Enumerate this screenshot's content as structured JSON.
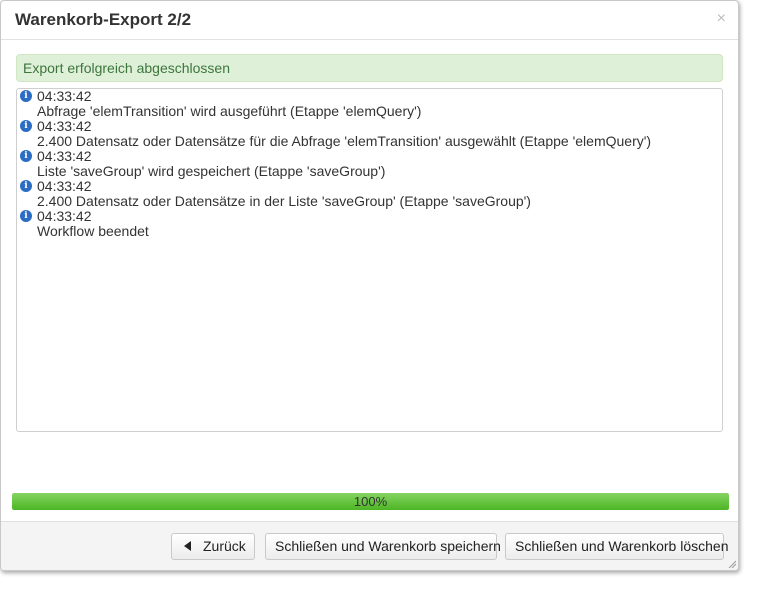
{
  "dialog": {
    "title": "Warenkorb-Export 2/2",
    "close_symbol": "×",
    "success_message": "Export erfolgreich abgeschlossen",
    "log": [
      {
        "time": "04:33:42",
        "message": "Abfrage 'elemTransition' wird ausgeführt (Etappe 'elemQuery')",
        "icon": "info-icon"
      },
      {
        "time": "04:33:42",
        "message": "2.400 Datensatz oder Datensätze für die Abfrage 'elemTransition' ausgewählt (Etappe 'elemQuery')",
        "icon": "info-icon"
      },
      {
        "time": "04:33:42",
        "message": "Liste 'saveGroup' wird gespeichert (Etappe 'saveGroup')",
        "icon": "info-icon"
      },
      {
        "time": "04:33:42",
        "message": "2.400 Datensatz oder Datensätze in der Liste 'saveGroup' (Etappe 'saveGroup')",
        "icon": "info-icon"
      },
      {
        "time": "04:33:42",
        "message": "Workflow beendet",
        "icon": "info-icon"
      }
    ],
    "progress": {
      "percent": 100,
      "label": "100%"
    },
    "buttons": {
      "back": "Zurück",
      "close_save": "Schließen und Warenkorb speichern",
      "close_delete": "Schließen und Warenkorb löschen"
    },
    "colors": {
      "success_bg": "#dff0d8",
      "success_text": "#3c763d",
      "progress": "#5cbf30",
      "info_icon": "#2b6cc4"
    }
  }
}
